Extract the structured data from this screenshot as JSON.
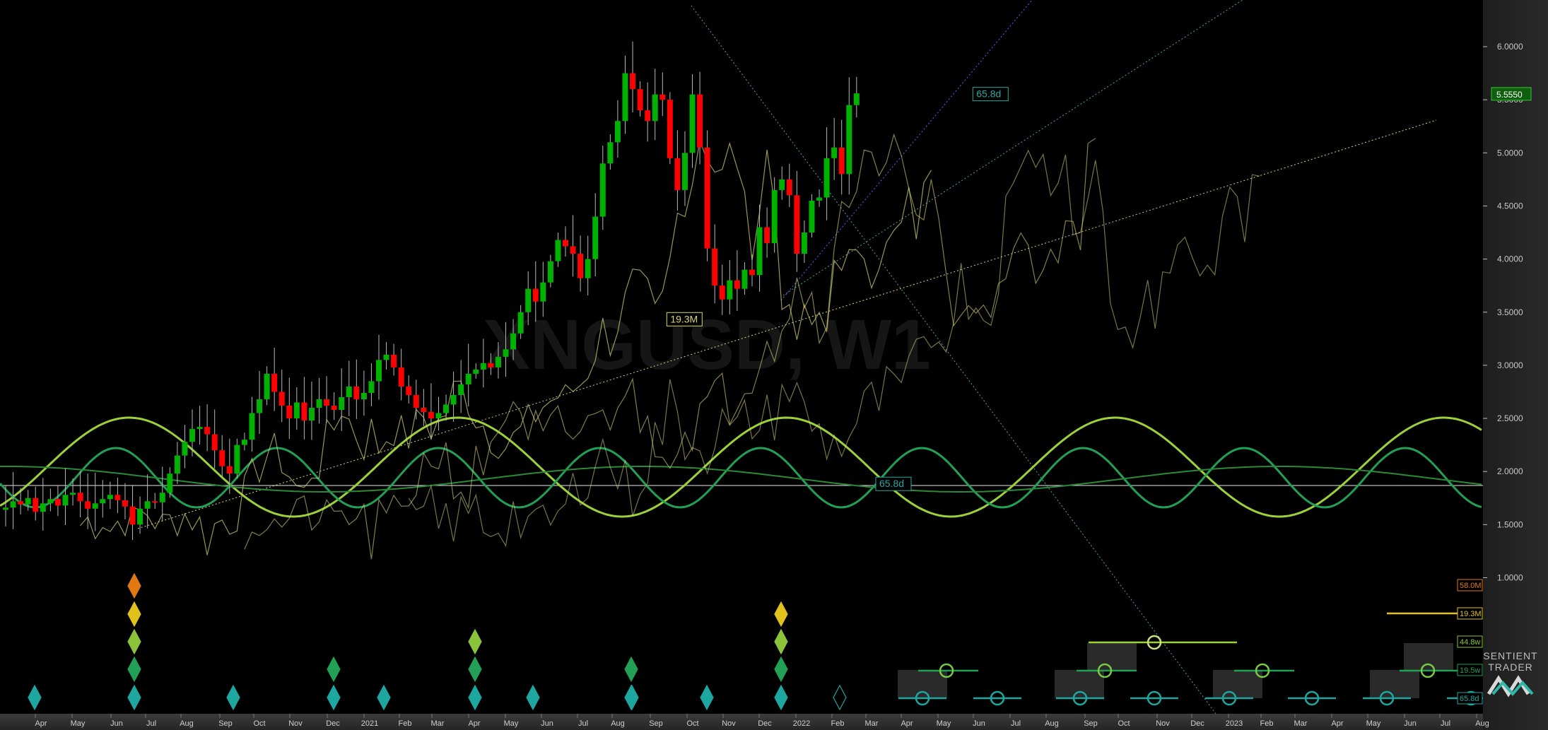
{
  "chart_data": {
    "type": "candlestick",
    "watermark": "XNGUSD, W1",
    "last_price": "5.5550",
    "y_ticks": [
      "6.0000",
      "5.5000",
      "5.0000",
      "4.5000",
      "4.0000",
      "3.5000",
      "3.0000",
      "2.5000",
      "2.0000",
      "1.5000",
      "1.0000"
    ],
    "y_values": [
      6.0,
      5.5,
      5.0,
      4.5,
      4.0,
      3.5,
      3.0,
      2.5,
      2.0,
      1.5,
      1.0
    ],
    "x_ticks": [
      "Apr",
      "May",
      "Jun",
      "Jul",
      "Aug",
      "Sep",
      "Oct",
      "Nov",
      "Dec",
      "2021",
      "Feb",
      "Mar",
      "Apr",
      "May",
      "Jun",
      "Jul",
      "Aug",
      "Sep",
      "Oct",
      "Nov",
      "Dec",
      "2022",
      "Feb",
      "Mar",
      "Apr",
      "May",
      "Jun",
      "Jul",
      "Aug",
      "Sep",
      "Oct",
      "Nov",
      "Dec",
      "2023",
      "Feb",
      "Mar",
      "Apr",
      "May",
      "Jun",
      "Jul",
      "Aug"
    ],
    "x_start": "2020-04-06",
    "ylim": [
      0.9,
      6.4
    ],
    "closes": [
      1.66,
      1.72,
      1.69,
      1.75,
      1.62,
      1.7,
      1.74,
      1.68,
      1.78,
      1.8,
      1.72,
      1.65,
      1.7,
      1.74,
      1.78,
      1.73,
      1.67,
      1.5,
      1.65,
      1.72,
      1.71,
      1.8,
      1.98,
      2.15,
      2.28,
      2.4,
      2.42,
      2.35,
      2.2,
      2.05,
      1.98,
      2.25,
      2.3,
      2.55,
      2.68,
      2.92,
      2.75,
      2.62,
      2.5,
      2.65,
      2.48,
      2.6,
      2.68,
      2.62,
      2.58,
      2.7,
      2.8,
      2.68,
      2.74,
      2.85,
      3.05,
      3.1,
      2.98,
      2.8,
      2.72,
      2.6,
      2.56,
      2.5,
      2.55,
      2.63,
      2.72,
      2.82,
      2.92,
      2.96,
      3.02,
      2.98,
      3.08,
      3.15,
      3.3,
      3.5,
      3.72,
      3.6,
      3.78,
      3.98,
      4.18,
      4.12,
      4.05,
      3.82,
      4.0,
      4.4,
      4.9,
      5.1,
      5.3,
      5.75,
      5.6,
      5.4,
      5.3,
      5.55,
      5.5,
      4.95,
      4.65,
      5.0,
      5.55,
      5.05,
      4.1,
      3.75,
      3.62,
      3.8,
      3.72,
      3.9,
      3.85,
      4.3,
      4.15,
      4.65,
      4.75,
      4.6,
      4.05,
      4.25,
      4.55,
      4.58,
      4.95,
      5.05,
      4.8,
      5.45,
      5.56
    ],
    "projections": [
      {
        "kind": "fld",
        "label": "19.3M",
        "value": 3.43,
        "date": "2021-12-17"
      },
      {
        "kind": "fld",
        "label": "65.8d",
        "value": 5.55,
        "date": "2022-09-30"
      },
      {
        "kind": "fld",
        "label": "65.8d",
        "value": 1.88,
        "date": "2022-07-01"
      }
    ],
    "cycle_legend": [
      "58.0M",
      "19.3M",
      "44.8w",
      "19.5w",
      "65.8d"
    ],
    "colors": {
      "up": "#00b200",
      "down": "#ff0000",
      "wick": "#b8b8b8",
      "fld": "#d8d47a",
      "sine_light": "#9dd13a",
      "sine_green": "#22a055",
      "trough": "#00b4b4",
      "blue_line": "#6060ff"
    }
  },
  "brand": {
    "line1": "SENTIENT",
    "line2": "TRADER"
  }
}
